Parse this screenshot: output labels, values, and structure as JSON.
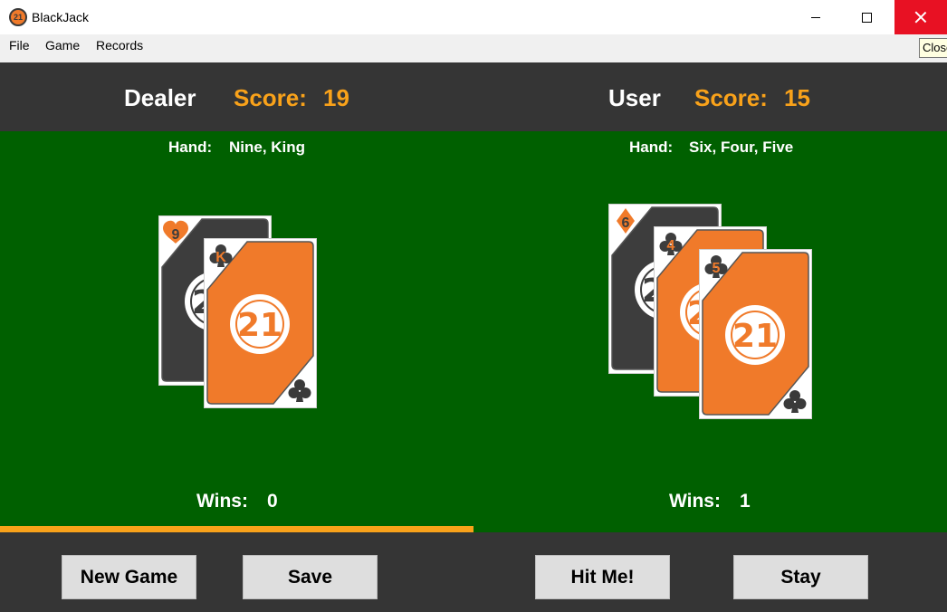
{
  "window": {
    "title": "BlackJack",
    "icon_text": "21",
    "tooltip": "Close"
  },
  "menu": [
    "File",
    "Game",
    "Records"
  ],
  "dealer": {
    "name": "Dealer",
    "score_label": "Score:",
    "score": "19",
    "hand_label": "Hand:",
    "hand": "Nine, King",
    "wins_label": "Wins:",
    "wins": "0",
    "cards": [
      {
        "rank": "9",
        "suit": "hearts",
        "back": "dark",
        "face_visible": false
      },
      {
        "rank": "K",
        "suit": "clubs",
        "back": "orange",
        "face_visible": true
      }
    ]
  },
  "user": {
    "name": "User",
    "score_label": "Score:",
    "score": "15",
    "hand_label": "Hand:",
    "hand": "Six, Four, Five",
    "wins_label": "Wins:",
    "wins": "1",
    "cards": [
      {
        "rank": "6",
        "suit": "diamonds",
        "back": "dark",
        "face_visible": false
      },
      {
        "rank": "4",
        "suit": "clubs",
        "back": "orange",
        "face_visible": false
      },
      {
        "rank": "5",
        "suit": "clubs",
        "back": "orange",
        "face_visible": true
      }
    ]
  },
  "card_logo": "21",
  "active_turn": "dealer",
  "buttons": {
    "new_game": "New Game",
    "save": "Save",
    "hit": "Hit Me!",
    "stay": "Stay"
  },
  "colors": {
    "table": "#006000",
    "panel": "#353535",
    "accent": "#f9a21a",
    "card_orange": "#f07a2a",
    "card_dark": "#3d3d3d"
  }
}
